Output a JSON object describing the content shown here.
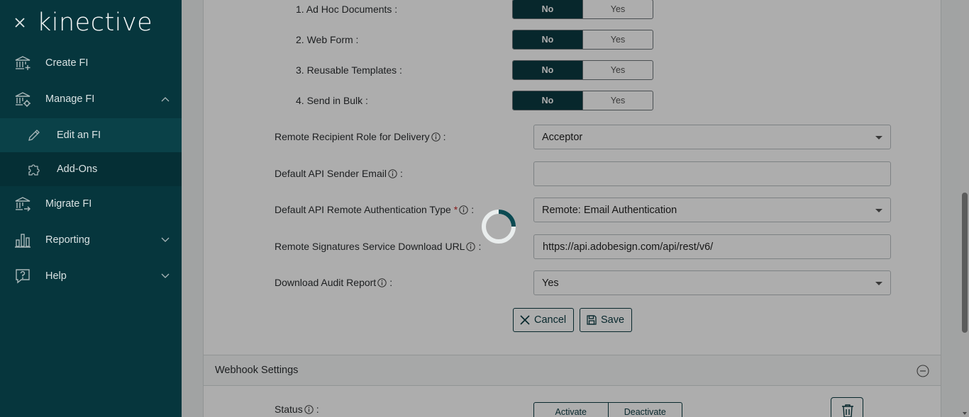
{
  "sidebar": {
    "brand": "kinective",
    "items": [
      {
        "label": "Create FI",
        "icon": "bank-plus-icon"
      },
      {
        "label": "Manage FI",
        "icon": "bank-gear-icon",
        "expanded": true
      },
      {
        "label": "Edit an FI",
        "icon": "pencil-icon",
        "sub": true,
        "active": true
      },
      {
        "label": "Add-Ons",
        "icon": "puzzle-icon",
        "sub": true
      },
      {
        "label": "Migrate FI",
        "icon": "bank-arrow-icon"
      },
      {
        "label": "Reporting",
        "icon": "bar-chart-icon"
      },
      {
        "label": "Help",
        "icon": "help-bubble-icon"
      }
    ]
  },
  "form": {
    "features": [
      {
        "label": "1. Ad Hoc Documents :",
        "no": "No",
        "yes": "Yes",
        "selected": "No"
      },
      {
        "label": "2. Web Form :",
        "no": "No",
        "yes": "Yes",
        "selected": "No"
      },
      {
        "label": "3. Reusable Templates :",
        "no": "No",
        "yes": "Yes",
        "selected": "No"
      },
      {
        "label": "4. Send in Bulk :",
        "no": "No",
        "yes": "Yes",
        "selected": "No"
      }
    ],
    "remote_role_label": "Remote Recipient Role for Delivery",
    "remote_role_value": "Acceptor",
    "sender_email_label": "Default API Sender Email",
    "sender_email_value": "",
    "auth_type_label": "Default API Remote Authentication Type",
    "auth_type_required": "*",
    "auth_type_value": "Remote: Email Authentication",
    "download_url_label": "Remote Signatures Service Download URL",
    "download_url_value": "https://api.adobesign.com/api/rest/v6/",
    "audit_label": "Download Audit Report",
    "audit_value": "Yes",
    "colon": ":",
    "cancel_label": "Cancel",
    "save_label": "Save"
  },
  "webhook": {
    "title": "Webhook Settings",
    "status_label": "Status",
    "activate_label": "Activate",
    "deactivate_label": "Deactivate"
  },
  "colors": {
    "sidebar_bg": "#06363d",
    "accent": "#0b3a42",
    "required": "#c62828"
  }
}
